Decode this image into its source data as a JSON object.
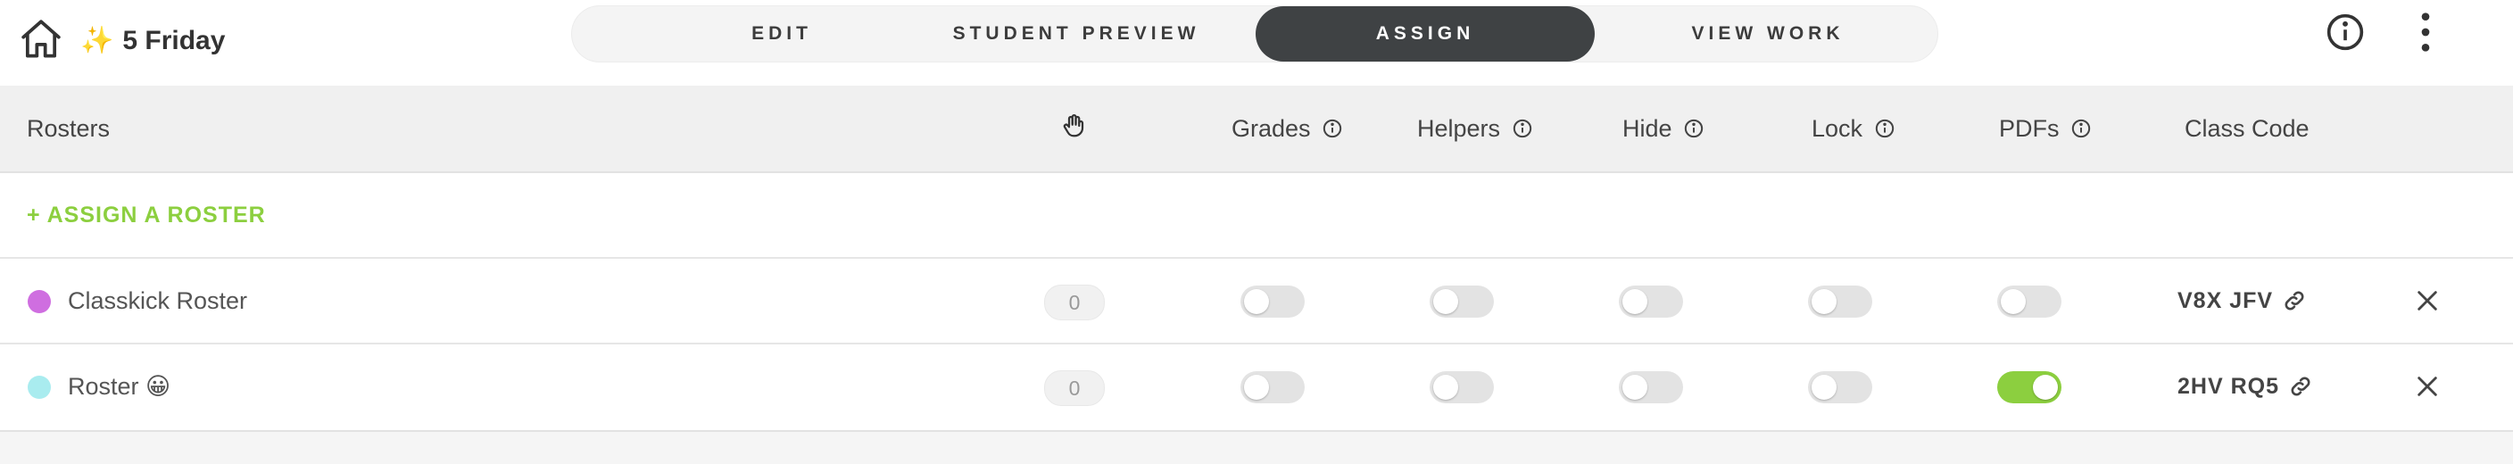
{
  "header": {
    "sparkle": "✨",
    "title": "5 Friday",
    "tabs": [
      {
        "label": "EDIT",
        "active": false
      },
      {
        "label": "STUDENT PREVIEW",
        "active": false
      },
      {
        "label": "ASSIGN",
        "active": true
      },
      {
        "label": "VIEW WORK",
        "active": false
      }
    ],
    "icons": [
      "home-icon",
      "info-icon",
      "more-vertical-icon"
    ]
  },
  "table": {
    "columns": {
      "rosters": "Rosters",
      "hand": "hand-icon",
      "grades": "Grades",
      "helpers": "Helpers",
      "hide": "Hide",
      "lock": "Lock",
      "pdfs": "PDFs",
      "class_code": "Class Code"
    },
    "assign_link": "+ ASSIGN A ROSTER",
    "rows": [
      {
        "name": "Classkick Roster",
        "dot_color": "#cf6ee0",
        "count": "0",
        "grades": false,
        "helpers": false,
        "hide": false,
        "lock": false,
        "pdfs": false,
        "class_code": "V8X JFV"
      },
      {
        "name": "Roster 😀",
        "dot_color": "#a9ecef",
        "count": "0",
        "grades": false,
        "helpers": false,
        "hide": false,
        "lock": false,
        "pdfs": true,
        "class_code": "2HV RQ5"
      }
    ]
  },
  "colors": {
    "accent_green": "#8ccf3f",
    "active_tab": "#3f4244"
  }
}
